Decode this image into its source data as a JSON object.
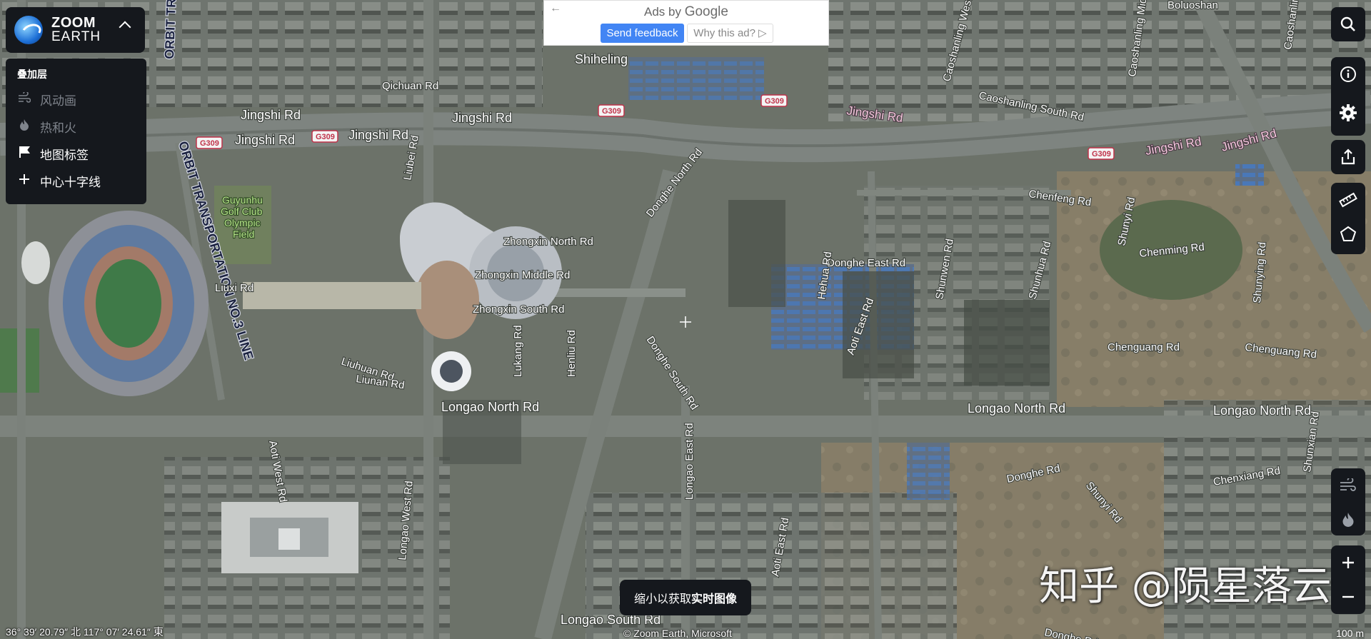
{
  "brand": {
    "line1": "ZOOM",
    "line2": "EARTH"
  },
  "layers": {
    "title": "叠加层",
    "items": [
      {
        "label": "风动画",
        "icon": "wind-icon",
        "enabled": false
      },
      {
        "label": "热和火",
        "icon": "fire-icon",
        "enabled": false
      },
      {
        "label": "地图标签",
        "icon": "flag-icon",
        "enabled": true
      },
      {
        "label": "中心十字线",
        "icon": "plus-icon",
        "enabled": true
      }
    ]
  },
  "ad": {
    "prefix": "Ads by ",
    "brand": "Google",
    "feedback": "Send feedback",
    "why": "Why this ad? ▷"
  },
  "controls": {
    "search": "search-icon",
    "info": "info-icon",
    "settings": "gear-icon",
    "share": "share-icon",
    "measure": "ruler-icon",
    "area": "polygon-icon",
    "wind": "wind-icon",
    "fire": "fire-icon",
    "zoom_in": "+",
    "zoom_out": "−"
  },
  "hint": {
    "prefix": "缩小以获取",
    "bold": "实时图像"
  },
  "status": {
    "coords": "36° 39′ 20.79″ 北  117° 07′ 24.61″ 東",
    "credit": "© Zoom Earth, Microsoft",
    "scale": "100 m"
  },
  "watermark": "知乎 @陨星落云",
  "map_labels": {
    "places": [
      "Shiheling",
      "Guyunhu",
      "Golf Club",
      "Olympic",
      "Field"
    ],
    "transit": [
      "ORBIT TRANSPORTATION NO.3 LINE",
      "ORBIT TRA"
    ],
    "roads": [
      "Qichuan Rd",
      "Jingshi Rd",
      "Jingshi Rd",
      "Jingshi Rd",
      "Jingshi Rd",
      "Jingshi Rd",
      "Jingshi Rd",
      "Caoshanling West Rd",
      "Caoshanling Middle Rd",
      "Caoshanling South Rd",
      "Caoshanling East Rd",
      "Boluoshan",
      "Liubei Rd",
      "Donghe North Rd",
      "Chenfeng Rd",
      "Shunyi Rd",
      "Chenming Rd",
      "Zhongxin North Rd",
      "Zhongxin Middle Rd",
      "Zhongxin South Rd",
      "Donghe East Rd",
      "Hehua Rd",
      "Shunwen Rd",
      "Shunhua Rd",
      "Shunying Rd",
      "Liuxi Rd",
      "Aoti East Rd",
      "Donghe South Rd",
      "Lukang Rd",
      "Henliu Rd",
      "Liuhuan Rd",
      "Liunan Rd",
      "Chenguang Rd",
      "Chenguang Rd",
      "Longao North Rd",
      "Longao North Rd",
      "Longao North Rd",
      "Shunxian Rd",
      "Aoti West Rd",
      "Longao West Rd",
      "Longao East Rd",
      "Donghe Rd",
      "Shunyi Rd",
      "Chenxiang Rd",
      "Aoti East Rd",
      "Longao South Rd",
      "Donghe Rd"
    ],
    "shields": [
      "G309",
      "G309",
      "G309",
      "G309",
      "G309"
    ]
  }
}
